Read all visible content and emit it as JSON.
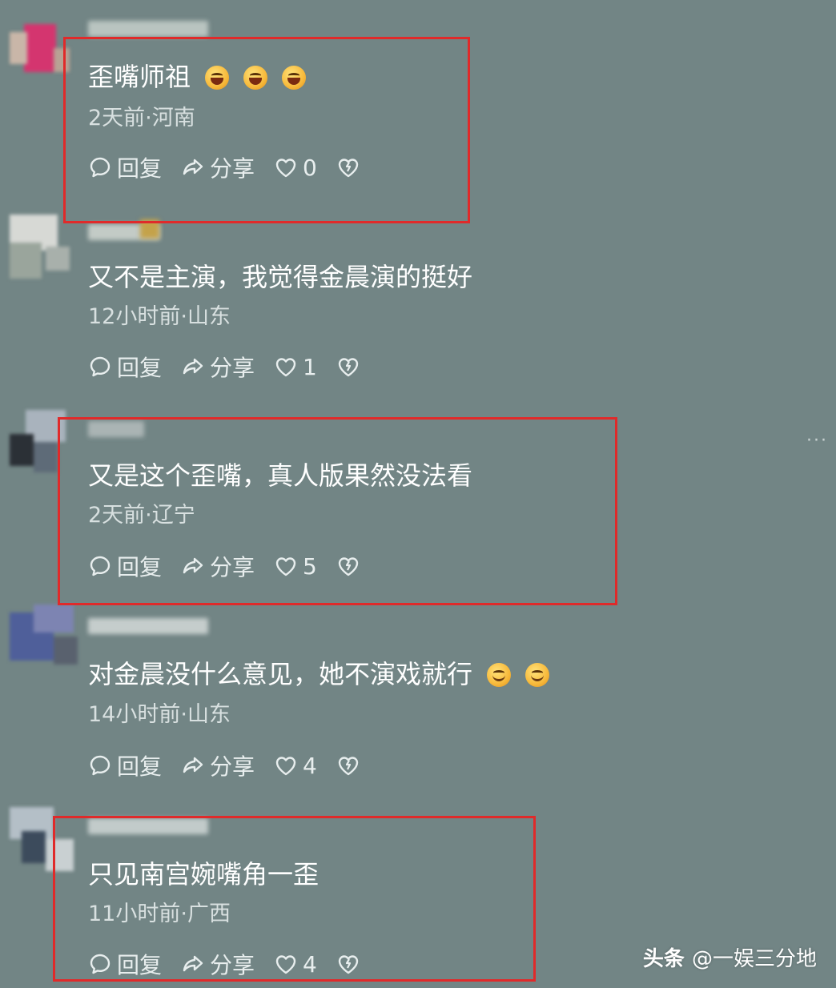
{
  "comments": [
    {
      "text": "歪嘴师祖",
      "emoji_after": [
        "laugh",
        "laugh",
        "laugh"
      ],
      "meta": "2天前·河南",
      "reply_label": "回复",
      "share_label": "分享",
      "likes": "0",
      "highlighted": true
    },
    {
      "text": "又不是主演，我觉得金晨演的挺好",
      "emoji_after": [],
      "meta": "12小时前·山东",
      "reply_label": "回复",
      "share_label": "分享",
      "likes": "1",
      "highlighted": false
    },
    {
      "text": "又是这个歪嘴，真人版果然没法看",
      "emoji_after": [],
      "meta": "2天前·辽宁",
      "reply_label": "回复",
      "share_label": "分享",
      "likes": "5",
      "highlighted": true
    },
    {
      "text": "对金晨没什么意见，她不演戏就行",
      "emoji_after": [
        "smile",
        "smile"
      ],
      "meta": "14小时前·山东",
      "reply_label": "回复",
      "share_label": "分享",
      "likes": "4",
      "highlighted": false
    },
    {
      "text": "只见南宫婉嘴角一歪",
      "emoji_after": [],
      "meta": "11小时前·广西",
      "reply_label": "回复",
      "share_label": "分享",
      "likes": "4",
      "highlighted": true
    }
  ],
  "more_menu": "···",
  "watermark": {
    "brand": "头条",
    "handle": "@一娱三分地"
  },
  "colors": {
    "background": "#728585",
    "highlight_border": "#e02a2a",
    "text": "#ffffff",
    "meta_text": "#d8e0e0"
  },
  "icons": {
    "reply": "speech-bubble-icon",
    "share": "share-arrow-icon",
    "like": "heart-icon",
    "dislike": "broken-heart-icon"
  }
}
